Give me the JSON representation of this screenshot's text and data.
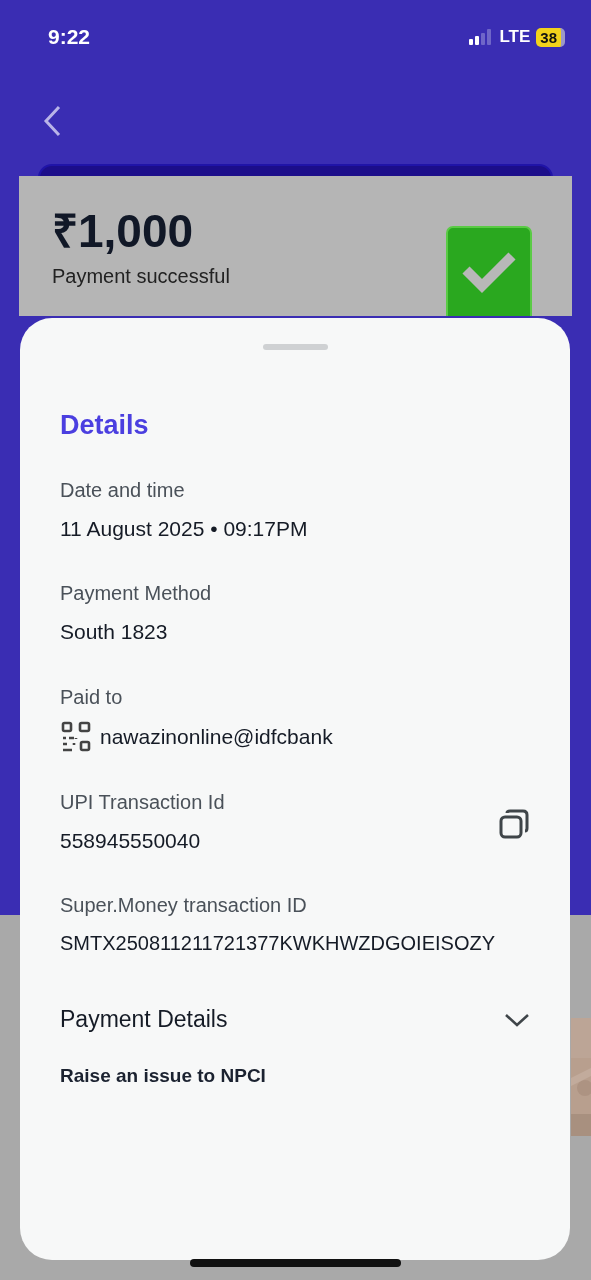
{
  "status_bar": {
    "time": "9:22",
    "network": "LTE",
    "battery": "38"
  },
  "receipt": {
    "amount": "₹1,000",
    "status": "Payment successful"
  },
  "sheet": {
    "title": "Details",
    "fields": [
      {
        "kind": "text",
        "label": "Date and time",
        "value": "11 August 2025 • 09:17PM"
      },
      {
        "kind": "text",
        "label": "Payment Method",
        "value": "South 1823"
      },
      {
        "kind": "upi",
        "label": "Paid to",
        "value": "nawazinonline@idfcbank"
      },
      {
        "kind": "copy",
        "label": "UPI Transaction Id",
        "value": "558945550040"
      },
      {
        "kind": "text",
        "label": "Super.Money transaction ID",
        "value": "SMTX250811211721377KWKHWZDGOIEISOZY"
      }
    ],
    "expander": {
      "label": "Payment Details",
      "expanded": false
    },
    "link": "Raise an issue to NPCI"
  }
}
